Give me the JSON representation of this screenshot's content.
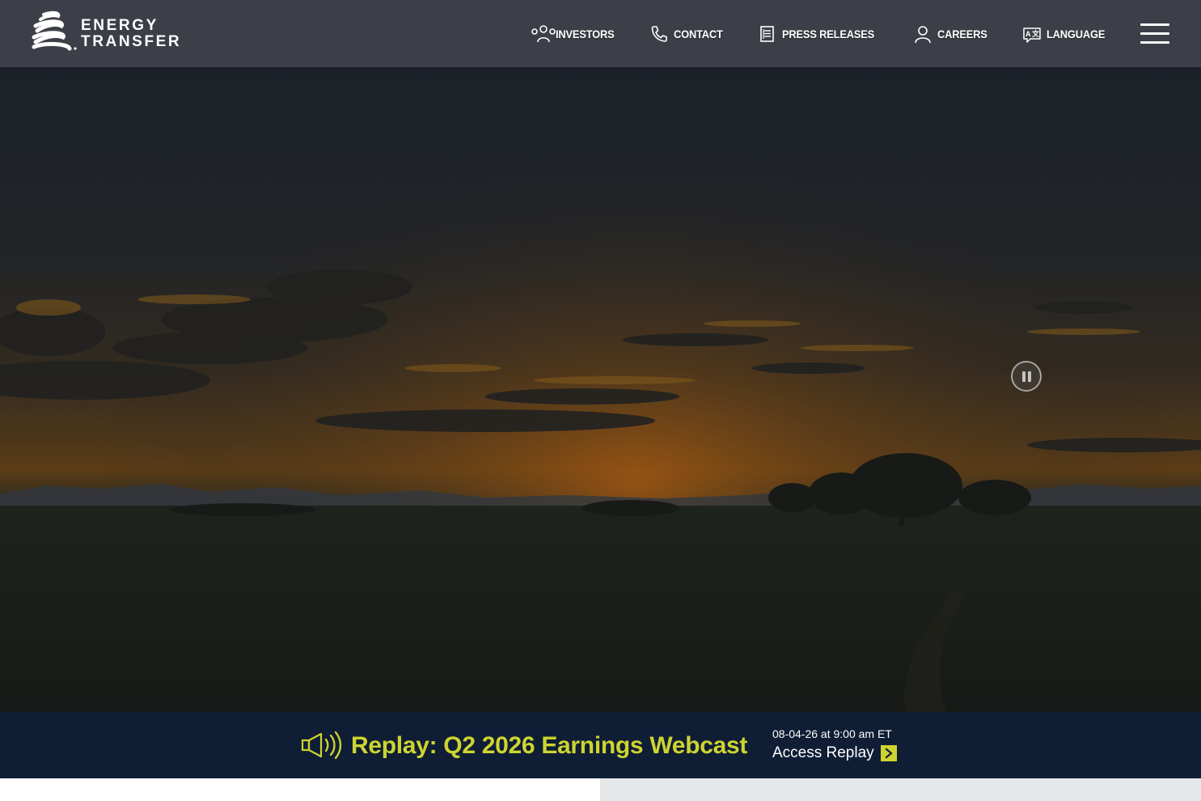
{
  "brand": {
    "name_line1": "ENERGY",
    "name_line2": "TRANSFER",
    "accent_color": "#cdd430",
    "navy_color": "#0f1d35"
  },
  "header": {
    "nav": [
      {
        "label": "INVESTORS",
        "icon": "investors-icon"
      },
      {
        "label": "CONTACT",
        "icon": "phone-icon"
      },
      {
        "label": "PRESS RELEASES",
        "icon": "document-icon"
      },
      {
        "label": "CAREERS",
        "icon": "person-icon"
      },
      {
        "label": "LANGUAGE",
        "icon": "translate-icon"
      }
    ],
    "menu_icon": "hamburger-icon"
  },
  "hero": {
    "media": "sunset-landscape-video",
    "pause_icon": "pause-icon"
  },
  "banner": {
    "icon": "megaphone-icon",
    "title": "Replay: Q2 2026 Earnings Webcast",
    "date": "08-04-26 at 9:00 am ET",
    "access_label": "Access Replay",
    "access_icon": "chevron-right-icon"
  }
}
